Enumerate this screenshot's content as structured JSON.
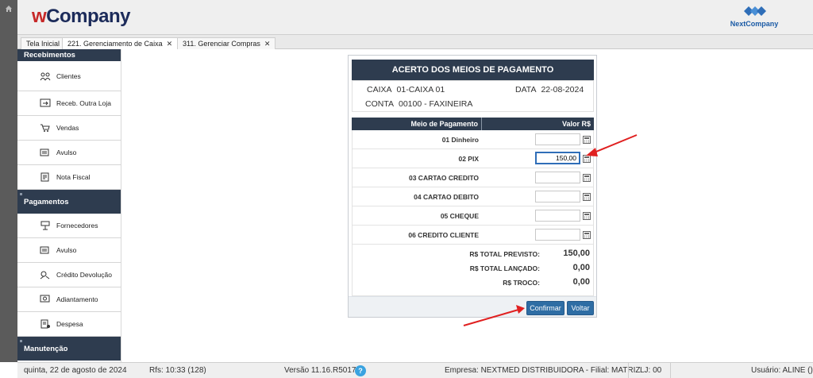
{
  "header": {
    "logo_w": "w",
    "logo_rest": "Company",
    "brand_right": "NextCompany"
  },
  "tabs": [
    {
      "label": "Tela Inicial"
    },
    {
      "label": "221. Gerenciamento de Caixa",
      "close": "✕"
    },
    {
      "label": "311. Gerenciar Compras",
      "close": "✕"
    }
  ],
  "sidebar": {
    "sections": [
      {
        "label": "Recebimentos",
        "items": [
          "Clientes",
          "Receb. Outra Loja",
          "Vendas",
          "Avulso",
          "Nota Fiscal"
        ]
      },
      {
        "label": "Pagamentos",
        "items": [
          "Fornecedores",
          "Avulso",
          "Crédito Devolução",
          "Adiantamento",
          "Despesa"
        ]
      },
      {
        "label": "Manutenção",
        "items": []
      }
    ]
  },
  "card": {
    "title": "ACERTO DOS MEIOS DE PAGAMENTO",
    "caixa_label": "CAIXA",
    "caixa_value": "01-CAIXA 01",
    "data_label": "DATA",
    "data_value": "22-08-2024",
    "conta_label": "CONTA",
    "conta_value": "00100 - FAXINEIRA",
    "col_meio": "Meio de Pagamento",
    "col_valor": "Valor R$",
    "rows": [
      {
        "label": "01 Dinheiro",
        "value": ""
      },
      {
        "label": "02 PIX",
        "value": "150,00"
      },
      {
        "label": "03 CARTAO CREDITO",
        "value": ""
      },
      {
        "label": "04 CARTAO DEBITO",
        "value": ""
      },
      {
        "label": "05 CHEQUE",
        "value": ""
      },
      {
        "label": "06 CREDITO CLIENTE",
        "value": ""
      }
    ],
    "totals": [
      {
        "label": "R$ TOTAL PREVISTO:",
        "value": "150,00"
      },
      {
        "label": "R$ TOTAL LANÇADO:",
        "value": "0,00"
      },
      {
        "label": "R$ TROCO:",
        "value": "0,00"
      }
    ],
    "confirm_label": "Confirmar",
    "back_label": "Voltar"
  },
  "status": {
    "datetime": "quinta, 22 de agosto de 2024",
    "rfs": "Rfs: 10:33 (128)",
    "version": "Versão 11.16.R5017",
    "help": "?",
    "empresa": "Empresa: NEXTMED DISTRIBUIDORA - Filial: MATRIZ",
    "lj": "LJ: 00",
    "usuario": "Usuário: ALINE ()"
  },
  "colors": {
    "navy": "#2e3c4f",
    "button_blue": "#2e6da4",
    "arrow_red": "#e02020"
  }
}
